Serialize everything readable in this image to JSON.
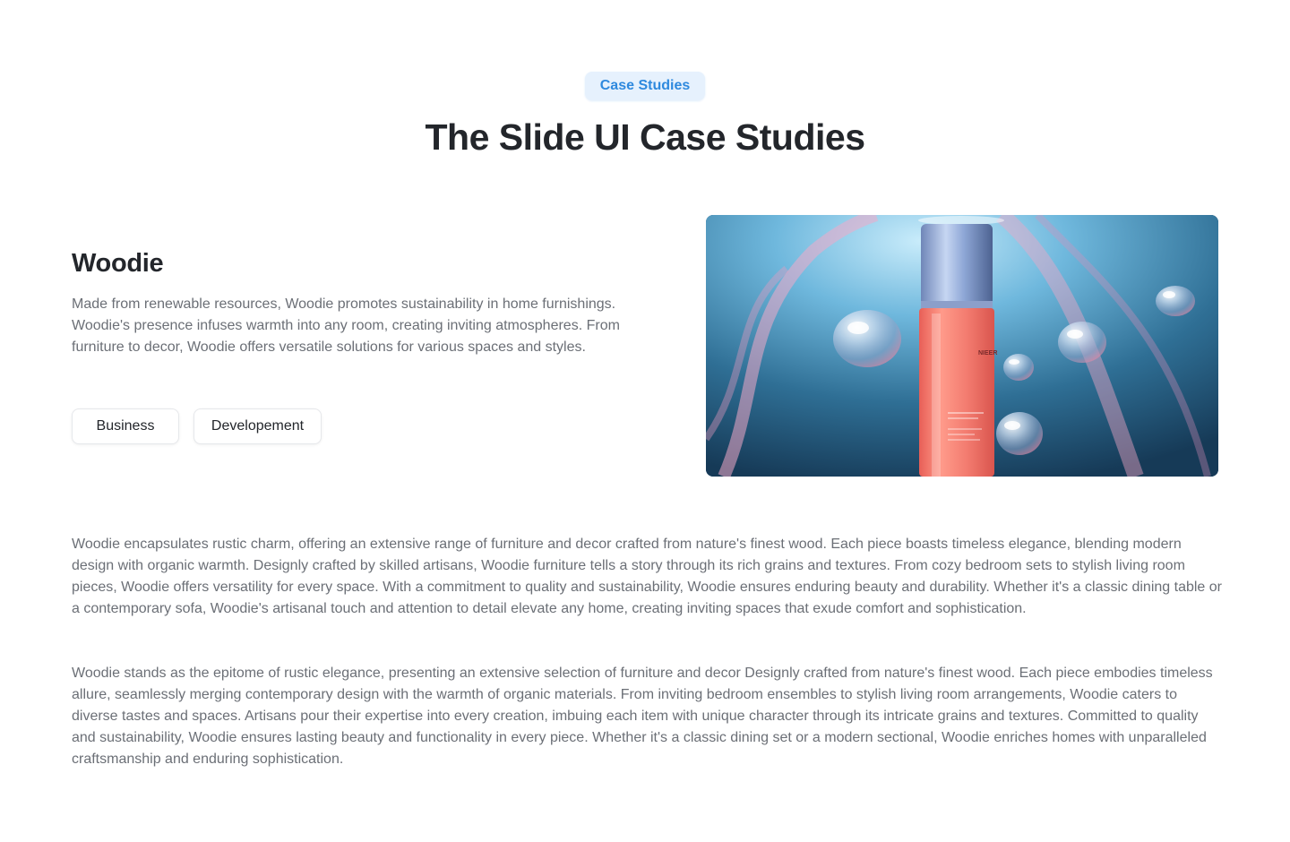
{
  "header": {
    "badge_label": "Case Studies",
    "title": "The Slide UI Case Studies"
  },
  "case": {
    "name": "Woodie",
    "description": "Made from renewable resources, Woodie promotes sustainability in home furnishings. Woodie's presence infuses warmth into any room, creating inviting atmospheres. From furniture to decor, Woodie offers versatile solutions for various spaces and styles.",
    "tags": [
      "Business",
      "Developement"
    ],
    "image": {
      "product_label": "NIEER",
      "icon": "product-bottle-image"
    }
  },
  "body": {
    "paragraph_1": "Woodie encapsulates rustic charm, offering an extensive range of furniture and decor crafted from nature's finest wood. Each piece boasts timeless elegance, blending modern design with organic warmth. Designly crafted by skilled artisans, Woodie furniture tells a story through its rich grains and textures. From cozy bedroom sets to stylish living room pieces, Woodie offers versatility for every space. With a commitment to quality and sustainability, Woodie ensures enduring beauty and durability. Whether it's a classic dining table or a contemporary sofa, Woodie's artisanal touch and attention to detail elevate any home, creating inviting spaces that exude comfort and sophistication.",
    "paragraph_2": "Woodie stands as the epitome of rustic elegance, presenting an extensive selection of furniture and decor Designly crafted from nature's finest wood. Each piece embodies timeless allure, seamlessly merging contemporary design with the warmth of organic materials. From inviting bedroom ensembles to stylish living room arrangements, Woodie caters to diverse tastes and spaces. Artisans pour their expertise into every creation, imbuing each item with unique character through its intricate grains and textures. Committed to quality and sustainability, Woodie ensures lasting beauty and functionality in every piece. Whether it's a classic dining set or a modern sectional, Woodie enriches homes with unparalleled craftsmanship and enduring sophistication."
  },
  "colors": {
    "accent": "#2e89de",
    "badge_bg": "#e6f1fd",
    "heading": "#23262b",
    "muted_text": "#6b6f76"
  }
}
